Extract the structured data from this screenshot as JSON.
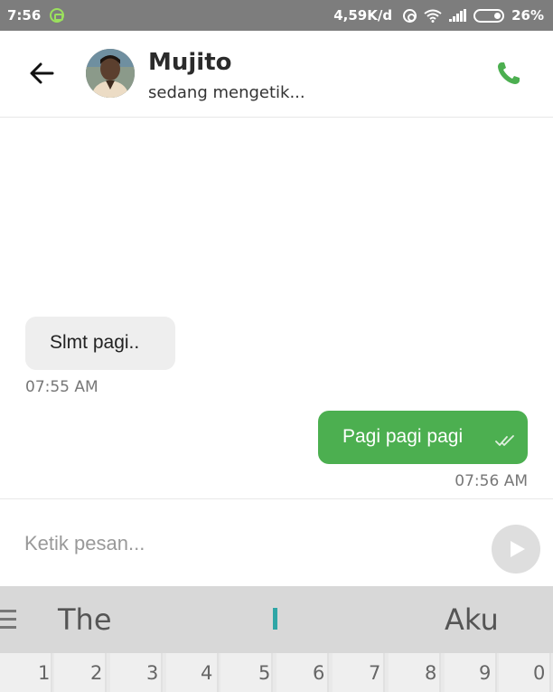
{
  "status_bar": {
    "time": "7:56",
    "network_speed": "4,59K/d",
    "battery": "26%",
    "icons": [
      "app-notification-icon",
      "hotspot-icon",
      "wifi-icon",
      "signal-icon",
      "battery-icon"
    ]
  },
  "header": {
    "contact_name": "Mujito",
    "contact_status": "sedang mengetik...",
    "icons": [
      "back-arrow-icon",
      "avatar",
      "phone-icon"
    ],
    "call_color": "#4caf50"
  },
  "messages": [
    {
      "direction": "incoming",
      "text": "Slmt pagi..",
      "time": "07:55 AM"
    },
    {
      "direction": "outgoing",
      "text": "Pagi pagi pagi",
      "time": "07:56 AM",
      "read_icon": "double-check-icon"
    }
  ],
  "input": {
    "placeholder": "Ketik pesan...",
    "value": ""
  },
  "keyboard": {
    "suggestions": [
      "The",
      "Aku"
    ],
    "number_keys": [
      "1",
      "2",
      "3",
      "4",
      "5",
      "6",
      "7",
      "8",
      "9",
      "0"
    ]
  },
  "colors": {
    "status_bar": "#7d7d7d",
    "outgoing_bubble": "#4caf50",
    "incoming_bubble": "#eeeeee",
    "suggestion_bar": "#d8d8d8"
  }
}
